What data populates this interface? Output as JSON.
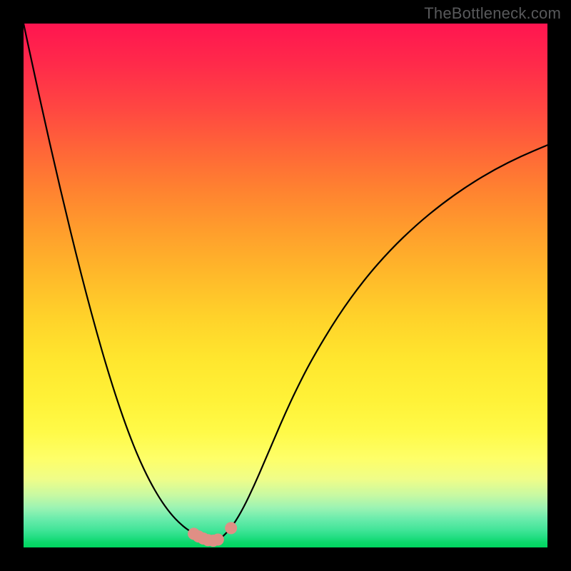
{
  "watermark": {
    "text": "TheBottleneck.com"
  },
  "colors": {
    "frame": "#000000",
    "curve_stroke": "#000000",
    "marker_fill": "#e08f85",
    "marker_stroke": "#b8726b",
    "gradient_top": "#ff1550",
    "gradient_bottom": "#00d65f"
  },
  "chart_data": {
    "type": "line",
    "title": "",
    "xlabel": "",
    "ylabel": "",
    "xlim": [
      0,
      100
    ],
    "ylim": [
      0,
      100
    ],
    "x": [
      0,
      2,
      4,
      6,
      8,
      10,
      12,
      14,
      16,
      18,
      20,
      22,
      24,
      26,
      28,
      30,
      32,
      34,
      35,
      36,
      37,
      38,
      40,
      42,
      44,
      46,
      48,
      50,
      52,
      55,
      60,
      65,
      70,
      75,
      80,
      85,
      90,
      95,
      100
    ],
    "values": [
      100,
      90.7,
      81.6,
      72.8,
      64.3,
      56.1,
      48.3,
      40.9,
      34.0,
      27.7,
      22.0,
      17.0,
      12.8,
      9.3,
      6.5,
      4.4,
      2.9,
      1.8,
      1.4,
      1.2,
      1.4,
      2.0,
      4.2,
      7.6,
      11.8,
      16.4,
      21.1,
      25.7,
      30.0,
      35.9,
      44.2,
      51.1,
      56.8,
      61.6,
      65.7,
      69.2,
      72.2,
      74.7,
      76.8
    ],
    "minimum": {
      "x": 36,
      "value": 1.2
    },
    "markers": [
      {
        "x": 32.5,
        "y": 2.6
      },
      {
        "x": 33.4,
        "y": 2.1
      },
      {
        "x": 34.3,
        "y": 1.7
      },
      {
        "x": 35.2,
        "y": 1.4
      },
      {
        "x": 36.2,
        "y": 1.3
      },
      {
        "x": 37.1,
        "y": 1.5
      },
      {
        "x": 39.6,
        "y": 3.7
      }
    ]
  }
}
